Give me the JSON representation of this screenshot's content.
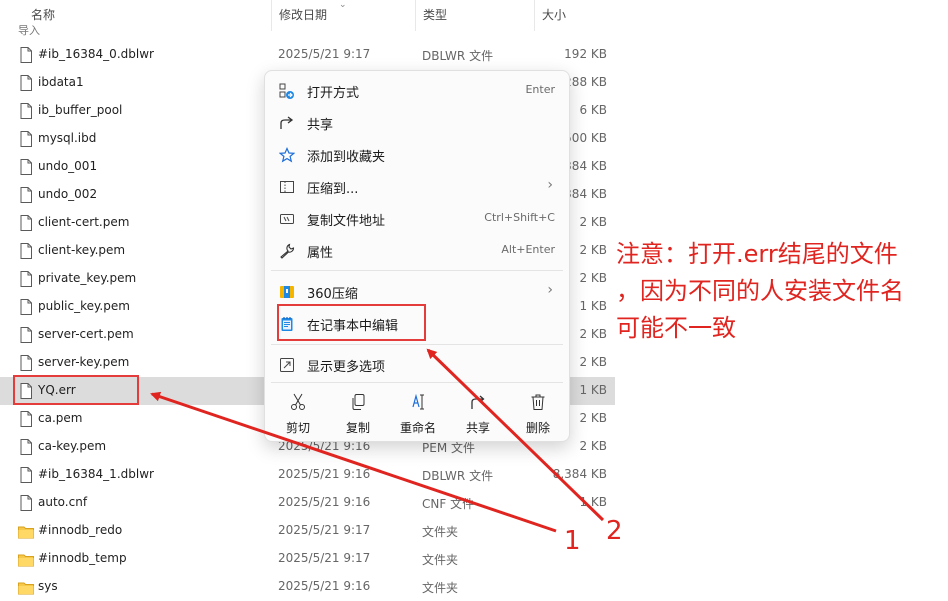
{
  "columns": {
    "name": "名称",
    "date": "修改日期",
    "type": "类型",
    "size": "大小"
  },
  "section_hint": "导入",
  "files": [
    {
      "name": "#ib_16384_0.dblwr",
      "date": "2025/5/21 9:17",
      "type": "DBLWR 文件",
      "size": "192 KB",
      "kind": "file"
    },
    {
      "name": "ibdata1",
      "date": "",
      "type": "",
      "size": "288 KB",
      "kind": "file"
    },
    {
      "name": "ib_buffer_pool",
      "date": "",
      "type": "",
      "size": "6 KB",
      "kind": "file"
    },
    {
      "name": "mysql.ibd",
      "date": "",
      "type": "",
      "size": "500 KB",
      "kind": "file"
    },
    {
      "name": "undo_001",
      "date": "",
      "type": "",
      "size": "384 KB",
      "kind": "file"
    },
    {
      "name": "undo_002",
      "date": "",
      "type": "",
      "size": "384 KB",
      "kind": "file"
    },
    {
      "name": "client-cert.pem",
      "date": "",
      "type": "",
      "size": "2 KB",
      "kind": "file"
    },
    {
      "name": "client-key.pem",
      "date": "",
      "type": "",
      "size": "2 KB",
      "kind": "file"
    },
    {
      "name": "private_key.pem",
      "date": "",
      "type": "",
      "size": "2 KB",
      "kind": "file"
    },
    {
      "name": "public_key.pem",
      "date": "",
      "type": "",
      "size": "1 KB",
      "kind": "file"
    },
    {
      "name": "server-cert.pem",
      "date": "",
      "type": "",
      "size": "2 KB",
      "kind": "file"
    },
    {
      "name": "server-key.pem",
      "date": "",
      "type": "",
      "size": "2 KB",
      "kind": "file"
    },
    {
      "name": "YQ.err",
      "date": "",
      "type": "",
      "size": "1 KB",
      "kind": "file",
      "selected": true
    },
    {
      "name": "ca.pem",
      "date": "",
      "type": "",
      "size": "2 KB",
      "kind": "file"
    },
    {
      "name": "ca-key.pem",
      "date": "2025/5/21 9:16",
      "type": "PEM 文件",
      "size": "2 KB",
      "kind": "file"
    },
    {
      "name": "#ib_16384_1.dblwr",
      "date": "2025/5/21 9:16",
      "type": "DBLWR 文件",
      "size": "8,384 KB",
      "kind": "file"
    },
    {
      "name": "auto.cnf",
      "date": "2025/5/21 9:16",
      "type": "CNF 文件",
      "size": "1 KB",
      "kind": "file"
    },
    {
      "name": "#innodb_redo",
      "date": "2025/5/21 9:17",
      "type": "文件夹",
      "size": "",
      "kind": "folder"
    },
    {
      "name": "#innodb_temp",
      "date": "2025/5/21 9:17",
      "type": "文件夹",
      "size": "",
      "kind": "folder"
    },
    {
      "name": "sys",
      "date": "2025/5/21 9:16",
      "type": "文件夹",
      "size": "",
      "kind": "folder"
    }
  ],
  "menu": {
    "items": [
      {
        "label": "打开方式",
        "shortcut": "Enter",
        "icon": "open-with-icon"
      },
      {
        "label": "共享",
        "shortcut": "",
        "icon": "share-icon"
      },
      {
        "label": "添加到收藏夹",
        "shortcut": "",
        "icon": "star-icon"
      },
      {
        "label": "压缩到...",
        "shortcut": "",
        "icon": "zip-icon",
        "submenu": true
      },
      {
        "label": "复制文件地址",
        "shortcut": "Ctrl+Shift+C",
        "icon": "copy-path-icon"
      },
      {
        "label": "属性",
        "shortcut": "Alt+Enter",
        "icon": "wrench-icon"
      },
      {
        "label": "360压缩",
        "shortcut": "",
        "icon": "360zip-icon",
        "submenu": true
      },
      {
        "label": "在记事本中编辑",
        "shortcut": "",
        "icon": "notepad-icon"
      },
      {
        "label": "显示更多选项",
        "shortcut": "",
        "icon": "more-options-icon"
      }
    ],
    "actions": [
      {
        "label": "剪切",
        "icon": "scissors-icon"
      },
      {
        "label": "复制",
        "icon": "copy-icon"
      },
      {
        "label": "重命名",
        "icon": "rename-icon"
      },
      {
        "label": "共享",
        "icon": "share-icon"
      },
      {
        "label": "删除",
        "icon": "trash-icon"
      }
    ]
  },
  "annotation": {
    "lines": [
      "注意：打开.err结尾的文件",
      "，因为不同的人安装文件名",
      "可能不一致"
    ],
    "label_1": "1",
    "label_2": "2",
    "color": "#e0241f"
  }
}
